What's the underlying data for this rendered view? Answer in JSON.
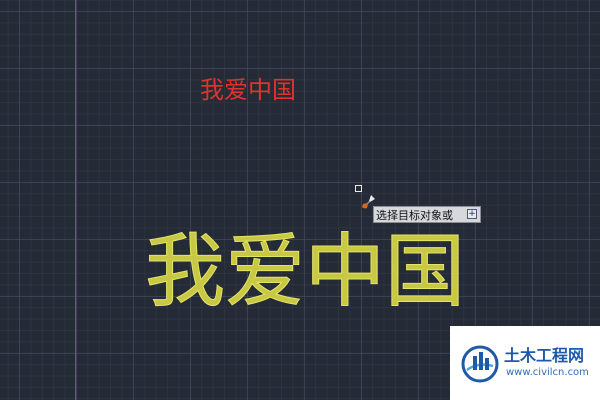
{
  "drawing": {
    "small_text": "我爱中国",
    "large_text": "我爱中国"
  },
  "cursor": {
    "pickbox_icon": "pickbox-square",
    "match_icon": "match-properties-brush-icon"
  },
  "tooltip": {
    "prompt": "选择目标对象或",
    "expand_icon": "+"
  },
  "watermark": {
    "title": "土木工程网",
    "url": "www.civilcn.com",
    "logo_icon": "civilcn-logo"
  },
  "colors": {
    "background": "#242a36",
    "small_text": "#e0332e",
    "large_text": "#c8c845",
    "axis": "#3f7a48"
  }
}
